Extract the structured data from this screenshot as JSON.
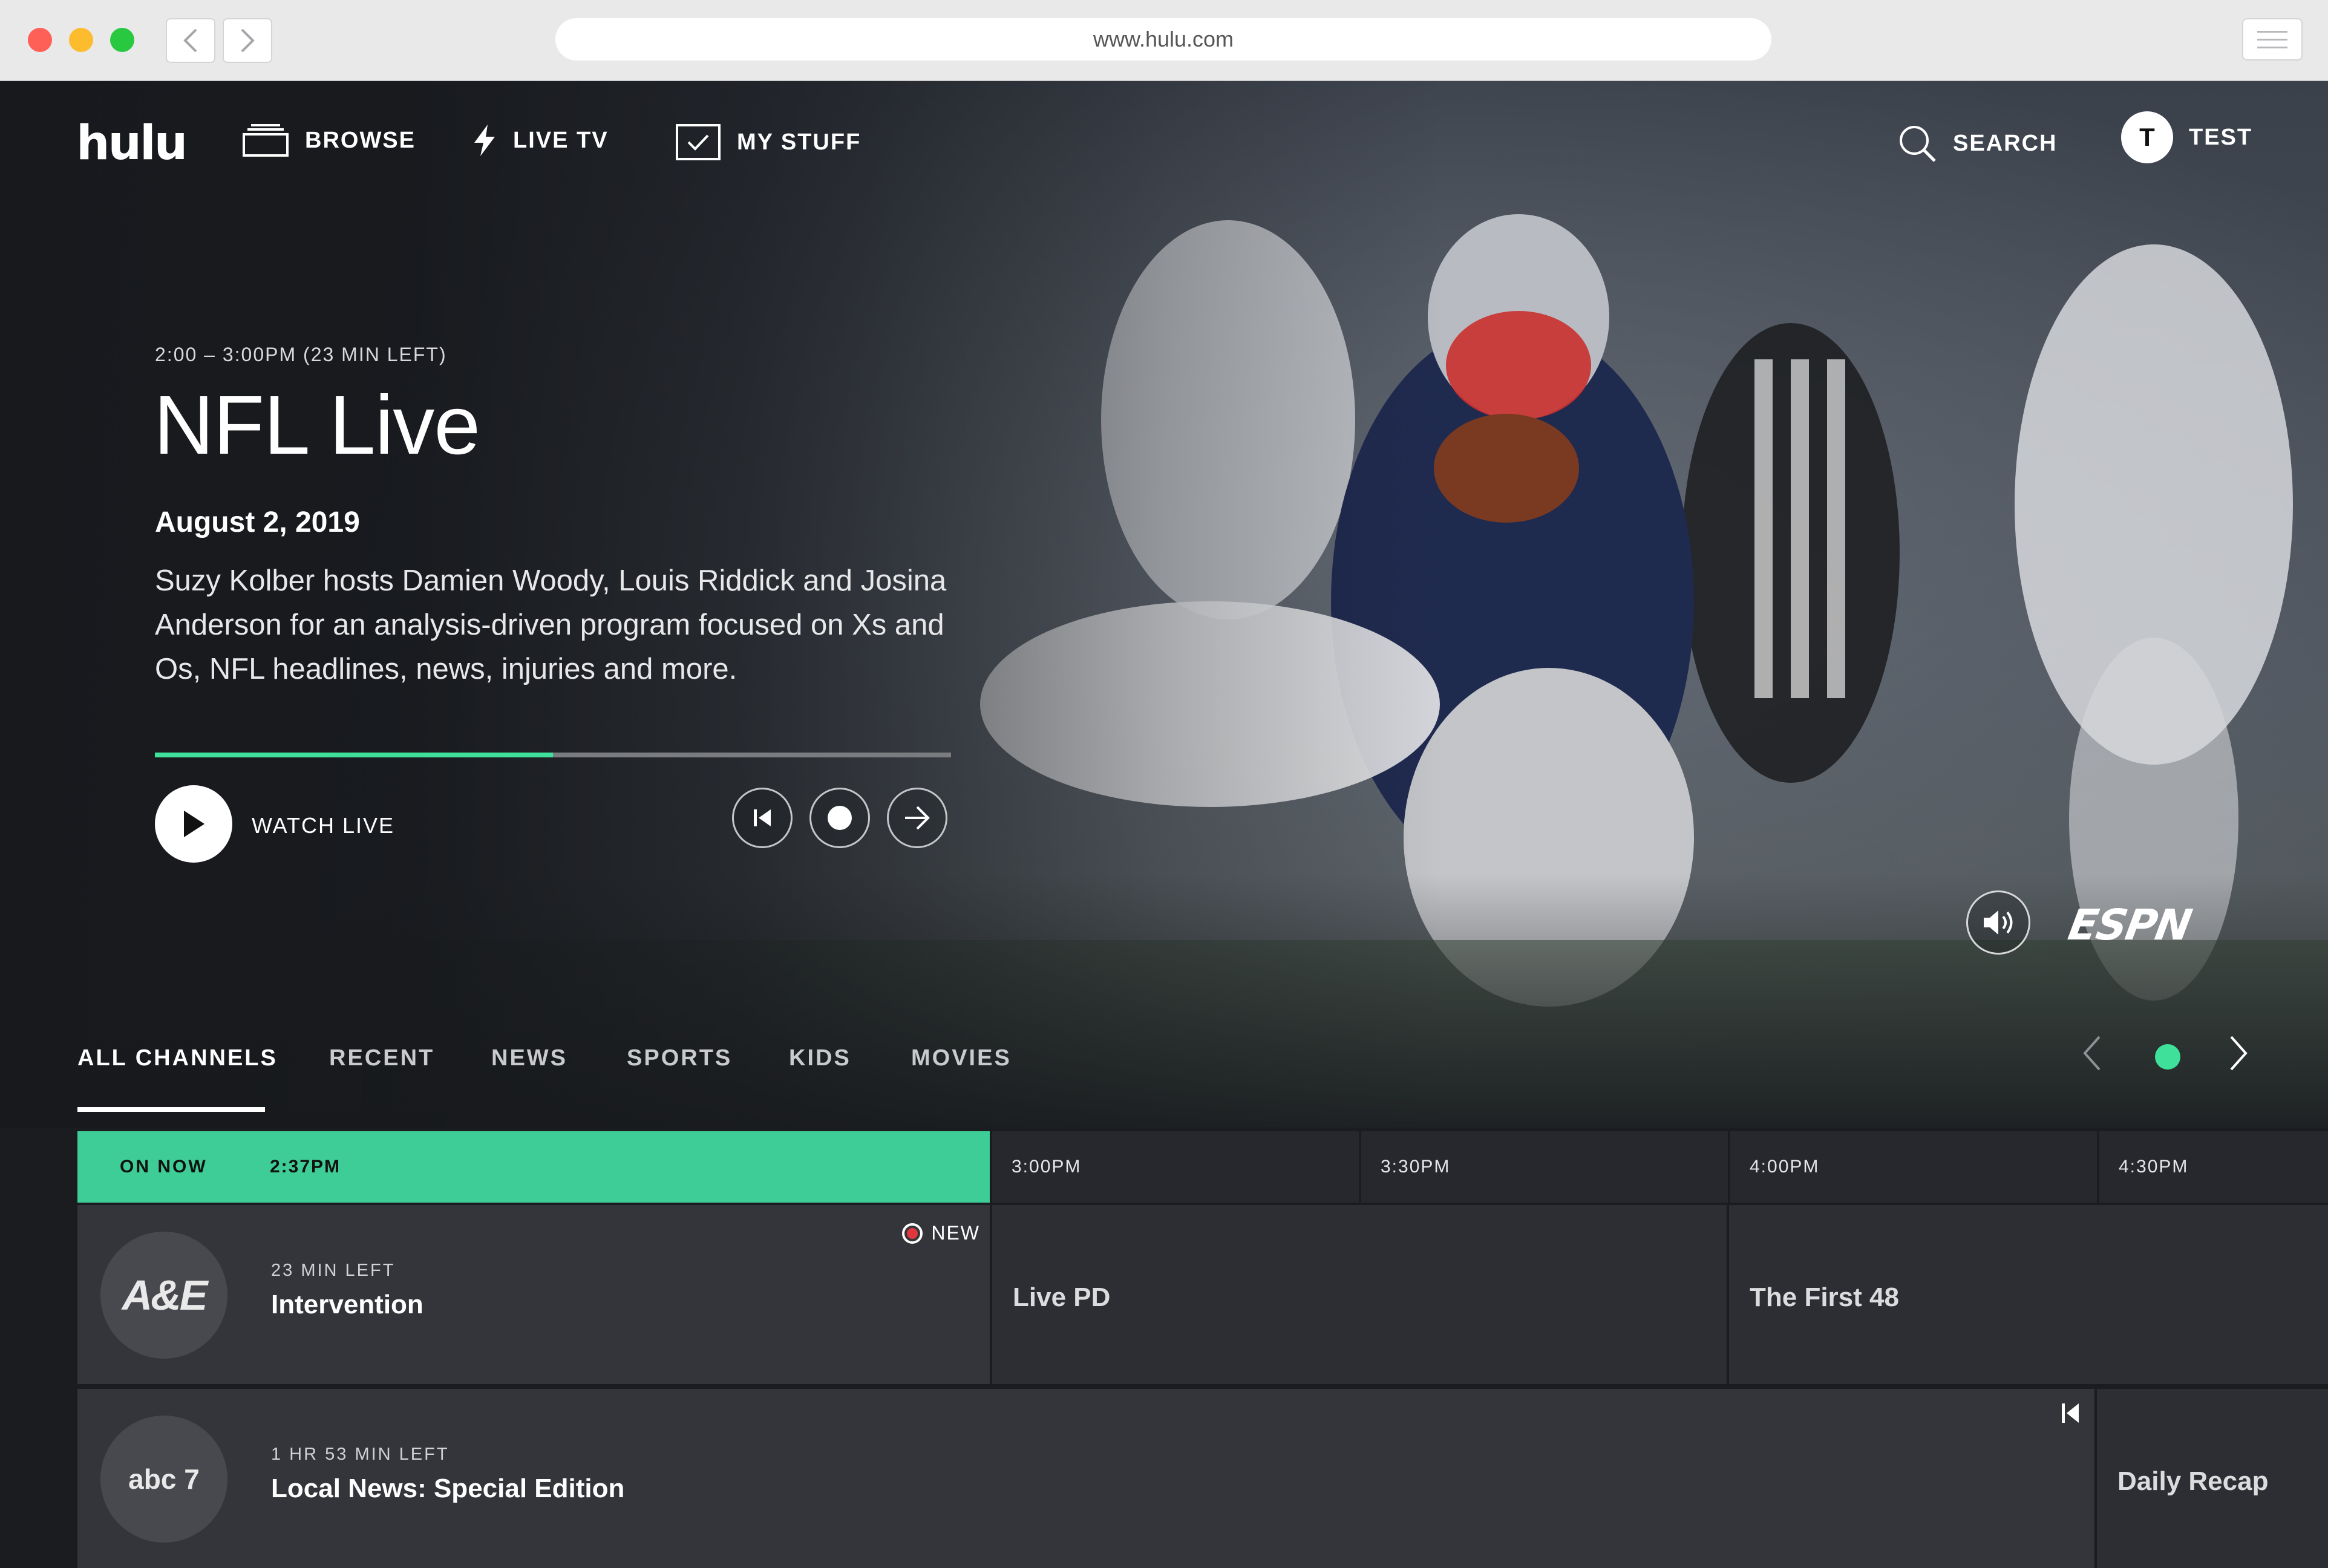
{
  "browser": {
    "url": "www.hulu.com"
  },
  "nav": {
    "logo": "hulu",
    "browse": "BROWSE",
    "live_tv": "LIVE TV",
    "my_stuff": "MY STUFF",
    "search": "SEARCH",
    "user_initial": "T",
    "user_name": "TEST"
  },
  "hero": {
    "timeslot": "2:00 – 3:00PM (23 MIN LEFT)",
    "title": "NFL Live",
    "date": "August 2, 2019",
    "description": "Suzy Kolber hosts Damien Woody, Louis Riddick and Josina Anderson for an analysis-driven program focused on Xs and Os, NFL headlines, news, injuries and more.",
    "progress_fraction": 0.5,
    "watch_label": "WATCH LIVE",
    "network": "ESPN"
  },
  "tabs": [
    {
      "label": "ALL CHANNELS",
      "active": true
    },
    {
      "label": "RECENT",
      "active": false
    },
    {
      "label": "NEWS",
      "active": false
    },
    {
      "label": "SPORTS",
      "active": false
    },
    {
      "label": "KIDS",
      "active": false
    },
    {
      "label": "MOVIES",
      "active": false
    }
  ],
  "guide": {
    "on_now_label": "ON NOW",
    "current_time": "2:37PM",
    "slots": [
      "3:00PM",
      "3:30PM",
      "4:00PM",
      "4:30PM"
    ],
    "rows": [
      {
        "channel_logo": "A&E",
        "time_left": "23 MIN LEFT",
        "current_title": "Intervention",
        "badge": "NEW",
        "later": [
          "Live PD",
          "The First 48"
        ]
      },
      {
        "channel_logo": "abc 7",
        "time_left": "1 HR 53 MIN LEFT",
        "current_title": "Local News: Special Edition",
        "later": [
          "Daily Recap"
        ]
      }
    ]
  },
  "colors": {
    "accent": "#3ee09a",
    "guide_on_now": "#3ecd96",
    "background": "#1a1c20",
    "record_dot": "#e0373e"
  },
  "icons": [
    "browse-icon",
    "bolt-icon",
    "checkbox-icon",
    "search-icon",
    "play-icon",
    "start-over-icon",
    "record-icon",
    "arrow-right-icon",
    "volume-icon",
    "chevron-left-icon",
    "chevron-right-icon"
  ]
}
